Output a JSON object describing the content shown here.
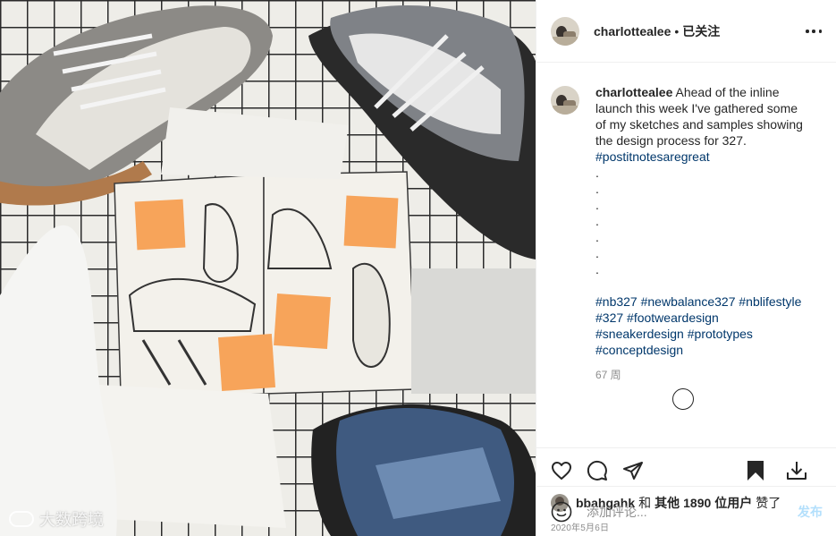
{
  "photo": {
    "alt": "",
    "watermark": "大数跨境"
  },
  "header": {
    "username": "charlottealee",
    "separator": "•",
    "follow_status": "已关注"
  },
  "caption": {
    "username": "charlottealee",
    "text": "Ahead of the inline launch this week I've gathered some of my sketches and samples showing the design process for 327.",
    "first_tag": "#postitnotesaregreat",
    "dots": [
      ".",
      ".",
      ".",
      ".",
      ".",
      ".",
      "."
    ],
    "hashtags": [
      "#nb327",
      "#newbalance327",
      "#nblifestyle",
      "#327",
      "#footweardesign",
      "#sneakerdesign",
      "#prototypes",
      "#conceptdesign"
    ],
    "time_ago": "67 周"
  },
  "actions": {
    "icons": [
      "heart-icon",
      "comment-icon",
      "share-icon",
      "bookmark-icon",
      "download-icon"
    ]
  },
  "likes": {
    "user": "bbahgahk",
    "and": "和",
    "others": "其他",
    "count": "1890",
    "suffix": "位用户",
    "liked": "赞了"
  },
  "date": "2020年5月6日",
  "comment_box": {
    "placeholder": "添加评论...",
    "post_label": "发布"
  },
  "colors": {
    "link": "#00376b",
    "muted": "#8e8e8e",
    "post_disabled": "#b2dffc",
    "sticky_note": "#f7a45a"
  }
}
